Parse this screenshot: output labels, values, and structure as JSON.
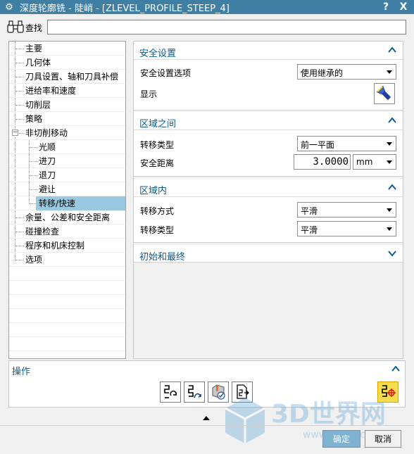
{
  "window": {
    "title": "深度轮廓铣 - 陡峭 - [ZLEVEL_PROFILE_STEEP_4]",
    "help_label": "?",
    "close_label": "X"
  },
  "find": {
    "label": "查找",
    "value": ""
  },
  "tree": {
    "items": [
      {
        "label": "主要",
        "level": 0
      },
      {
        "label": "几何体",
        "level": 0
      },
      {
        "label": "刀具设置、轴和刀具补偿",
        "level": 0
      },
      {
        "label": "进给率和速度",
        "level": 0
      },
      {
        "label": "切削层",
        "level": 0
      },
      {
        "label": "策略",
        "level": 0
      },
      {
        "label": "非切削移动",
        "level": 0,
        "expanded": true
      },
      {
        "label": "光顺",
        "level": 1
      },
      {
        "label": "进刀",
        "level": 1
      },
      {
        "label": "退刀",
        "level": 1
      },
      {
        "label": "避让",
        "level": 1
      },
      {
        "label": "转移/快速",
        "level": 1,
        "selected": true
      },
      {
        "label": "余量、公差和安全距离",
        "level": 0
      },
      {
        "label": "碰撞检查",
        "level": 0
      },
      {
        "label": "程序和机床控制",
        "level": 0
      },
      {
        "label": "选项",
        "level": 0
      }
    ]
  },
  "safety": {
    "title": "安全设置",
    "option_label": "安全设置选项",
    "option_value": "使用继承的",
    "display_label": "显示",
    "display_icon": "flashlight-icon"
  },
  "between_regions": {
    "title": "区域之间",
    "transfer_type_label": "转移类型",
    "transfer_type_value": "前一平面",
    "safe_distance_label": "安全距离",
    "safe_distance_value": "3.0000",
    "safe_distance_unit": "mm"
  },
  "within_region": {
    "title": "区域内",
    "transfer_mode_label": "转移方式",
    "transfer_mode_value": "平滑",
    "transfer_type_label": "转移类型",
    "transfer_type_value": "平滑"
  },
  "initial_final": {
    "title": "初始和最终"
  },
  "operations": {
    "title": "操作",
    "buttons": [
      "regenerate-icon",
      "replay-icon",
      "verify-icon",
      "list-icon",
      "generate-icon"
    ]
  },
  "footer": {
    "ok_label": "确定",
    "cancel_label": "取消"
  },
  "watermark": {
    "text": "3D世界网",
    "url": "www.3dsjw.com"
  },
  "colors": {
    "titlebar": "#3f7fa3",
    "group_title": "#0c5c8c",
    "tree_selection": "#99c9e0",
    "ok_button": "#7fb1d0",
    "generate_button": "#f7dc4d"
  }
}
